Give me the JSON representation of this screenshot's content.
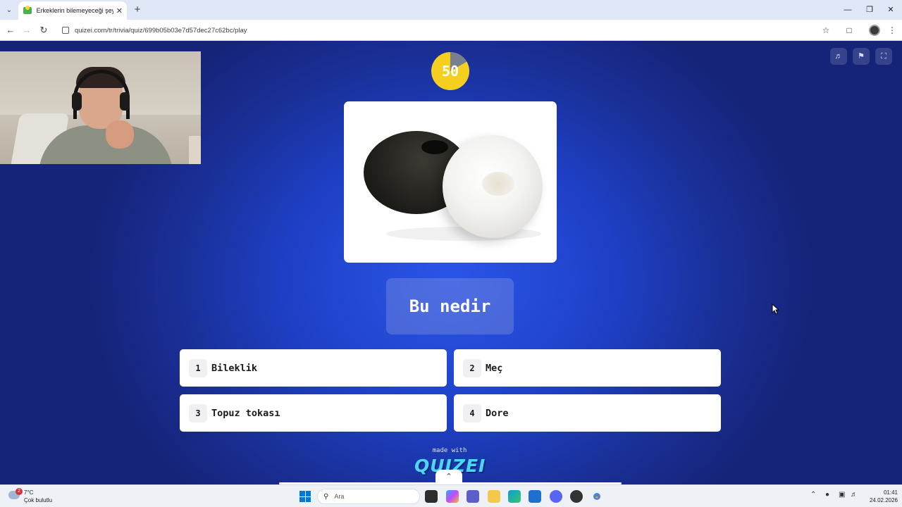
{
  "browser": {
    "tab_title": "Erkeklerin bilemeyeceği şeyler -",
    "url": "quizei.com/tr/trivia/quiz/699b05b03e7d57dec27c62bc/play",
    "icons": {
      "tab_search": "chevron-down-icon",
      "close": "close-icon",
      "new_tab": "plus-icon",
      "back": "arrow-left-icon",
      "forward": "arrow-right-icon",
      "reload": "reload-icon",
      "bookmark": "star-icon",
      "extensions": "puzzle-icon",
      "menu": "kebab-icon"
    }
  },
  "quiz": {
    "timer": "50",
    "question": "Bu nedir",
    "answers": [
      {
        "number": "1",
        "label": "Bileklik"
      },
      {
        "number": "2",
        "label": "Meç"
      },
      {
        "number": "3",
        "label": "Topuz tokası"
      },
      {
        "number": "4",
        "label": "Dore"
      }
    ],
    "made_with": "made with",
    "brand": "QUIZEI",
    "colors": {
      "timer": "#f5cf1f",
      "background": "#1e40c6",
      "brand": "#4dd6f5"
    }
  },
  "taskbar": {
    "weather_badge": "2",
    "weather_temp": "7°C",
    "weather_desc": "Çok bulutlu",
    "search_placeholder": "Ara",
    "time": "01:41",
    "date": "24.02.2026"
  }
}
